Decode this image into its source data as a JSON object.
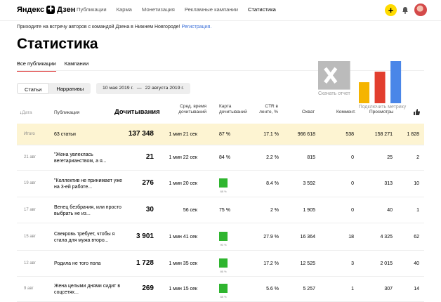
{
  "header": {
    "logo_text": "Яндекс",
    "logo_glyph": "✚",
    "logo_suffix": "Дзен",
    "nav": [
      "Публикации",
      "Карма",
      "Монетизация",
      "Рекламные кампании",
      "Статистика"
    ],
    "active_nav": "Статистика",
    "plus_label": "+"
  },
  "banner": {
    "text": "Приходите на встречу авторов с командой Дзена в Нижнем Новгороде!",
    "link": "Регистрация."
  },
  "page_title": "Статистика",
  "tabs": [
    "Все публикации",
    "Кампании"
  ],
  "actions": {
    "report": "Скачать отчет",
    "metrika": "Подключить метрику"
  },
  "segment": [
    "Статьи",
    "Нарративы"
  ],
  "date_range": {
    "from": "10 мая 2019 г.",
    "sep": "—",
    "to": "22 августа 2019 г."
  },
  "columns": {
    "date": "Дата",
    "pub": "Публикация",
    "reads": "Дочитывания",
    "time": "Сред. время дочитываний",
    "map": "Карта дочитываний",
    "ctr": "CTR в ленте, %",
    "reach": "Охват",
    "comments": "Коммент.",
    "views": "Просмотры"
  },
  "rows": [
    {
      "date": "Итого",
      "title": "63 статьи",
      "reads": "137 348",
      "time": "1 мин 21 сек",
      "map": "87 %",
      "ctr": "17.1 %",
      "reach": "966 618",
      "comments": "538",
      "views": "158 271",
      "likes": "1 828"
    },
    {
      "date": "21 авг",
      "title": "\"Жена увлеклась вегетарианством, а я...",
      "reads": "21",
      "time": "1 мин 22 сек",
      "map": "84 %",
      "ctr": "2.2 %",
      "reach": "815",
      "comments": "0",
      "views": "25",
      "likes": "2"
    },
    {
      "date": "19 авг",
      "title": "\"Коллектив не принимает уже на 3-ей работе...",
      "reads": "276",
      "time": "1 мин 20 сек",
      "map_bar": "88 %",
      "ctr": "8.4 %",
      "reach": "3 592",
      "comments": "0",
      "views": "313",
      "likes": "10"
    },
    {
      "date": "17 авг",
      "title": "Венец безбрачия, или просто выбрать не из...",
      "reads": "30",
      "time": "56 сек",
      "map": "75 %",
      "ctr": "2 %",
      "reach": "1 905",
      "comments": "0",
      "views": "40",
      "likes": "1"
    },
    {
      "date": "15 авг",
      "title": "Свекровь требует, чтобы я стала для мужа второ...",
      "reads": "3 901",
      "time": "1 мин 41 сек",
      "map_bar": "90 %",
      "ctr": "27.9 %",
      "reach": "16 364",
      "comments": "18",
      "views": "4 325",
      "likes": "62"
    },
    {
      "date": "12 авг",
      "title": "Родила не того пола",
      "reads": "1 728",
      "time": "1 мин 35 сек",
      "map_bar": "86 %",
      "ctr": "17.2 %",
      "reach": "12 525",
      "comments": "3",
      "views": "2 015",
      "likes": "40"
    },
    {
      "date": "9 авг",
      "title": "Жена целыми днями сидит в соцсетях...",
      "reads": "269",
      "time": "1 мин 15 сек",
      "map_bar": "88 %",
      "ctr": "5.6 %",
      "reach": "5 257",
      "comments": "1",
      "views": "307",
      "likes": "14"
    }
  ],
  "colors": {
    "accent": "#ffdb00",
    "total_row": "#fdf4d2",
    "map_bar": "#2fb52f",
    "link": "#3a6fd8"
  }
}
